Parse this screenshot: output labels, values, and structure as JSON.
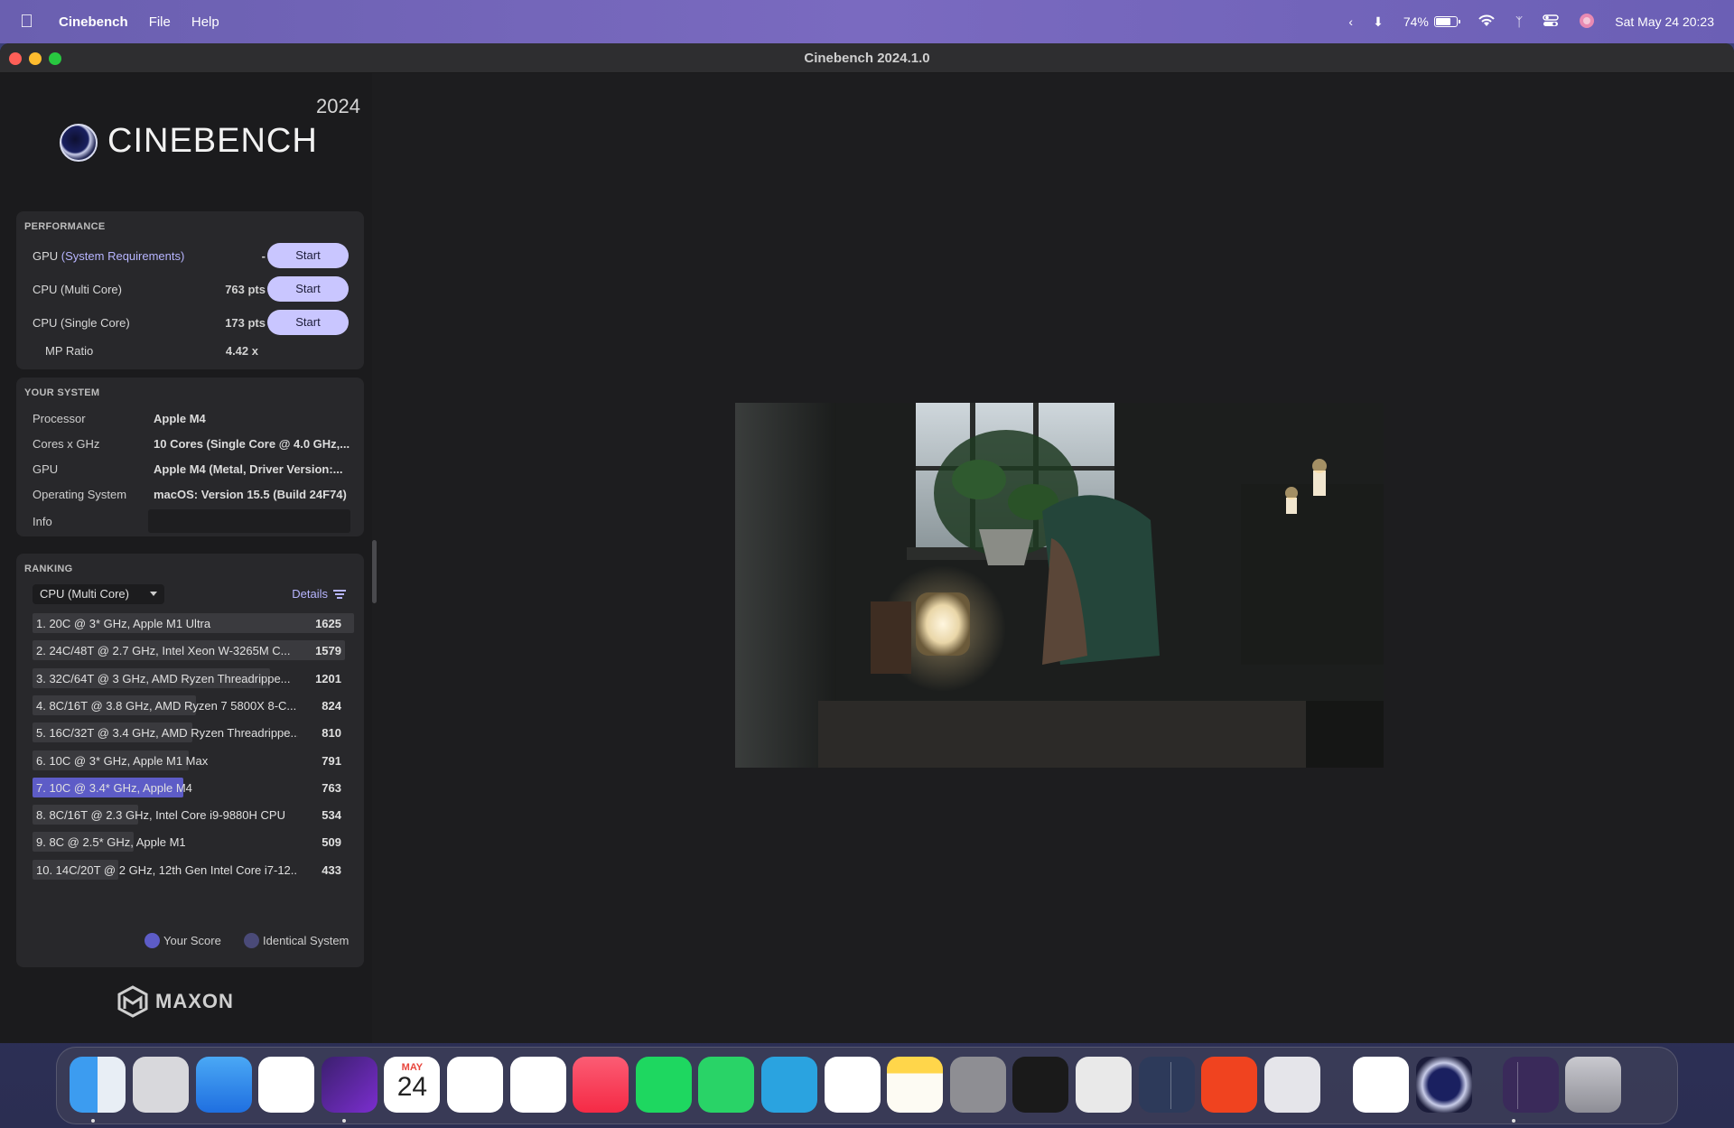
{
  "menubar": {
    "app_name": "Cinebench",
    "menus": [
      "File",
      "Help"
    ],
    "battery_percent": "74%",
    "battery_level": 0.74,
    "datetime": "Sat May 24  20:23"
  },
  "window": {
    "title": "Cinebench 2024.1.0"
  },
  "logo": {
    "name": "CINEBENCH",
    "year": "2024",
    "vendor": "MAXON"
  },
  "performance": {
    "title": "PERFORMANCE",
    "gpu_label": "GPU",
    "gpu_link": "(System Requirements)",
    "gpu_score": "-",
    "cpu_multi_label": "CPU (Multi Core)",
    "cpu_multi_score": "763 pts",
    "cpu_single_label": "CPU (Single Core)",
    "cpu_single_score": "173 pts",
    "mp_ratio_label": "MP Ratio",
    "mp_ratio_value": "4.42 x",
    "start_label": "Start"
  },
  "system": {
    "title": "YOUR SYSTEM",
    "processor_label": "Processor",
    "processor_value": "Apple M4",
    "cores_label": "Cores x GHz",
    "cores_value": "10 Cores (Single Core @ 4.0 GHz,...",
    "gpu_label": "GPU",
    "gpu_value": "Apple M4 (Metal, Driver Version:...",
    "os_label": "Operating System",
    "os_value": "macOS: Version 15.5 (Build 24F74)",
    "info_label": "Info",
    "info_value": ""
  },
  "ranking": {
    "title": "RANKING",
    "selected": "CPU (Multi Core)",
    "details_label": "Details",
    "max_score": 1625,
    "rows": [
      {
        "name": "1. 20C @ 3* GHz, Apple M1 Ultra",
        "score": 1625,
        "pts": "1625",
        "mine": false
      },
      {
        "name": "2. 24C/48T @ 2.7 GHz, Intel Xeon W-3265M C...",
        "score": 1579,
        "pts": "1579",
        "mine": false
      },
      {
        "name": "3. 32C/64T @ 3 GHz, AMD Ryzen Threadrippe...",
        "score": 1201,
        "pts": "1201",
        "mine": false
      },
      {
        "name": "4. 8C/16T @ 3.8 GHz, AMD Ryzen 7 5800X 8-C...",
        "score": 824,
        "pts": "824",
        "mine": false
      },
      {
        "name": "5. 16C/32T @ 3.4 GHz, AMD Ryzen Threadrippe...",
        "score": 810,
        "pts": "810",
        "mine": false
      },
      {
        "name": "6. 10C @ 3* GHz, Apple M1 Max",
        "score": 791,
        "pts": "791",
        "mine": false
      },
      {
        "name": "7. 10C @ 3.4* GHz, Apple M4",
        "score": 763,
        "pts": "763",
        "mine": true
      },
      {
        "name": "8. 8C/16T @ 2.3 GHz, Intel Core i9-9880H CPU",
        "score": 534,
        "pts": "534",
        "mine": false
      },
      {
        "name": "9. 8C @ 2.5* GHz, Apple M1",
        "score": 509,
        "pts": "509",
        "mine": false
      },
      {
        "name": "10. 14C/20T @ 2 GHz, 12th Gen Intel Core i7-12...",
        "score": 433,
        "pts": "433",
        "mine": false
      }
    ],
    "legend_your_score": "Your Score",
    "legend_identical": "Identical System",
    "your_score_color": "#5d5cc7",
    "identical_color": "#4a4a78"
  },
  "dock": {
    "calendar_month": "MAY",
    "calendar_day": "24",
    "icons": [
      "finder-icon",
      "launchpad-icon",
      "mail-icon",
      "photos-icon",
      "affinity-icon",
      "calendar-icon",
      "word-icon",
      "screen-capture-icon",
      "music-icon",
      "spotify-icon",
      "whatsapp-icon",
      "telegram-icon",
      "reminders-icon",
      "notes-icon",
      "system-settings-icon",
      "terminal-icon",
      "python-icon",
      "davinci-icon",
      "s-app-icon",
      "infuse-icon",
      "vscode-icon",
      "cinebench-icon",
      "folder-stack-icon",
      "trash-icon"
    ]
  }
}
